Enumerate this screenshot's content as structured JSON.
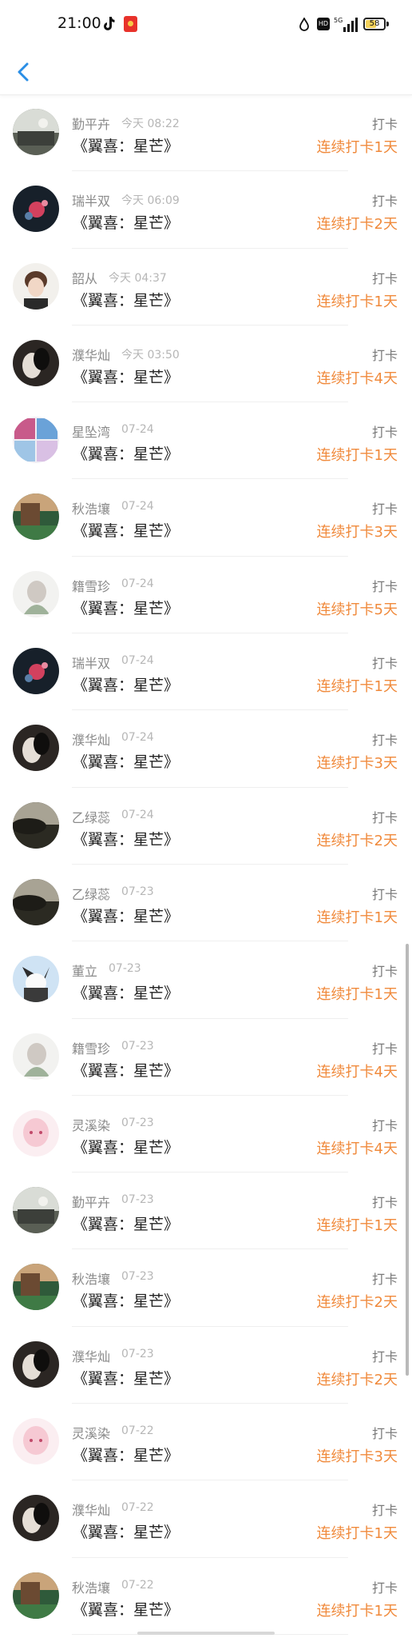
{
  "status_bar": {
    "time": "21:00",
    "battery": "58",
    "battery_level": 58,
    "network": "5G",
    "hd": "HD"
  },
  "header": {
    "back_icon": "chevron-left-icon",
    "accent": "#2a8ee6"
  },
  "colors": {
    "streak": "#f08a3c",
    "muted": "#8a8a8a"
  },
  "records": [
    {
      "name": "勤平卉",
      "time": "今天 08:22",
      "book": "《翼喜：星芒》",
      "action": "打卡",
      "streak": "连续打卡1天",
      "avatar": "avatar-qinpinghui"
    },
    {
      "name": "瑞半双",
      "time": "今天 06:09",
      "book": "《翼喜：星芒》",
      "action": "打卡",
      "streak": "连续打卡2天",
      "avatar": "avatar-ruibanshuang"
    },
    {
      "name": "韶从",
      "time": "今天 04:37",
      "book": "《翼喜：星芒》",
      "action": "打卡",
      "streak": "连续打卡1天",
      "avatar": "avatar-shaocong"
    },
    {
      "name": "濮华灿",
      "time": "今天 03:50",
      "book": "《翼喜：星芒》",
      "action": "打卡",
      "streak": "连续打卡4天",
      "avatar": "avatar-puhuacan"
    },
    {
      "name": "星坠湾",
      "time": "07-24",
      "book": "《翼喜：星芒》",
      "action": "打卡",
      "streak": "连续打卡1天",
      "avatar": "avatar-xingzhuiwan"
    },
    {
      "name": "秋浩壤",
      "time": "07-24",
      "book": "《翼喜：星芒》",
      "action": "打卡",
      "streak": "连续打卡3天",
      "avatar": "avatar-qiuhaorang"
    },
    {
      "name": "籍雪珍",
      "time": "07-24",
      "book": "《翼喜：星芒》",
      "action": "打卡",
      "streak": "连续打卡5天",
      "avatar": "avatar-jixuezhen"
    },
    {
      "name": "瑞半双",
      "time": "07-24",
      "book": "《翼喜：星芒》",
      "action": "打卡",
      "streak": "连续打卡1天",
      "avatar": "avatar-ruibanshuang"
    },
    {
      "name": "濮华灿",
      "time": "07-24",
      "book": "《翼喜：星芒》",
      "action": "打卡",
      "streak": "连续打卡3天",
      "avatar": "avatar-puhuacan"
    },
    {
      "name": "乙绿蕊",
      "time": "07-24",
      "book": "《翼喜：星芒》",
      "action": "打卡",
      "streak": "连续打卡2天",
      "avatar": "avatar-yilvrui"
    },
    {
      "name": "乙绿蕊",
      "time": "07-23",
      "book": "《翼喜：星芒》",
      "action": "打卡",
      "streak": "连续打卡1天",
      "avatar": "avatar-yilvrui"
    },
    {
      "name": "董立",
      "time": "07-23",
      "book": "《翼喜：星芒》",
      "action": "打卡",
      "streak": "连续打卡1天",
      "avatar": "avatar-dongli"
    },
    {
      "name": "籍雪珍",
      "time": "07-23",
      "book": "《翼喜：星芒》",
      "action": "打卡",
      "streak": "连续打卡4天",
      "avatar": "avatar-jixuezhen"
    },
    {
      "name": "灵溪染",
      "time": "07-23",
      "book": "《翼喜：星芒》",
      "action": "打卡",
      "streak": "连续打卡4天",
      "avatar": "avatar-lingxiran"
    },
    {
      "name": "勤平卉",
      "time": "07-23",
      "book": "《翼喜：星芒》",
      "action": "打卡",
      "streak": "连续打卡1天",
      "avatar": "avatar-qinpinghui"
    },
    {
      "name": "秋浩壤",
      "time": "07-23",
      "book": "《翼喜：星芒》",
      "action": "打卡",
      "streak": "连续打卡2天",
      "avatar": "avatar-qiuhaorang"
    },
    {
      "name": "濮华灿",
      "time": "07-23",
      "book": "《翼喜：星芒》",
      "action": "打卡",
      "streak": "连续打卡2天",
      "avatar": "avatar-puhuacan"
    },
    {
      "name": "灵溪染",
      "time": "07-22",
      "book": "《翼喜：星芒》",
      "action": "打卡",
      "streak": "连续打卡3天",
      "avatar": "avatar-lingxiran"
    },
    {
      "name": "濮华灿",
      "time": "07-22",
      "book": "《翼喜：星芒》",
      "action": "打卡",
      "streak": "连续打卡1天",
      "avatar": "avatar-puhuacan"
    },
    {
      "name": "秋浩壤",
      "time": "07-22",
      "book": "《翼喜：星芒》",
      "action": "打卡",
      "streak": "连续打卡1天",
      "avatar": "avatar-qiuhaorang"
    }
  ]
}
